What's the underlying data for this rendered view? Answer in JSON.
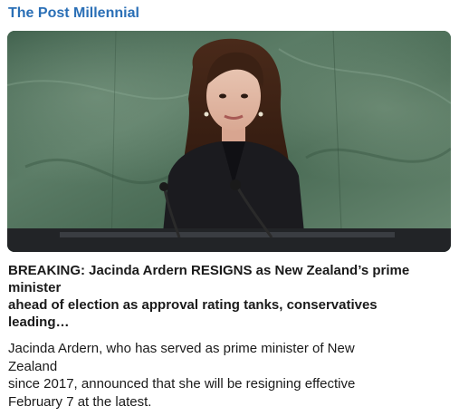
{
  "card": {
    "source": "The Post Millennial",
    "headline_lines": [
      "BREAKING: Jacinda Ardern RESIGNS as New Zealand’s prime",
      "minister",
      "ahead of election as approval rating tanks, conservatives",
      "leading…"
    ],
    "summary_lines": [
      "Jacinda Ardern, who has served as prime minister of New",
      "Zealand",
      "since 2017, announced that she will be resigning effective",
      "February 7 at the latest."
    ]
  },
  "colors": {
    "source_link": "#2a6fb6",
    "marble_green": "#4d6e58",
    "text": "#1a1a1a"
  }
}
